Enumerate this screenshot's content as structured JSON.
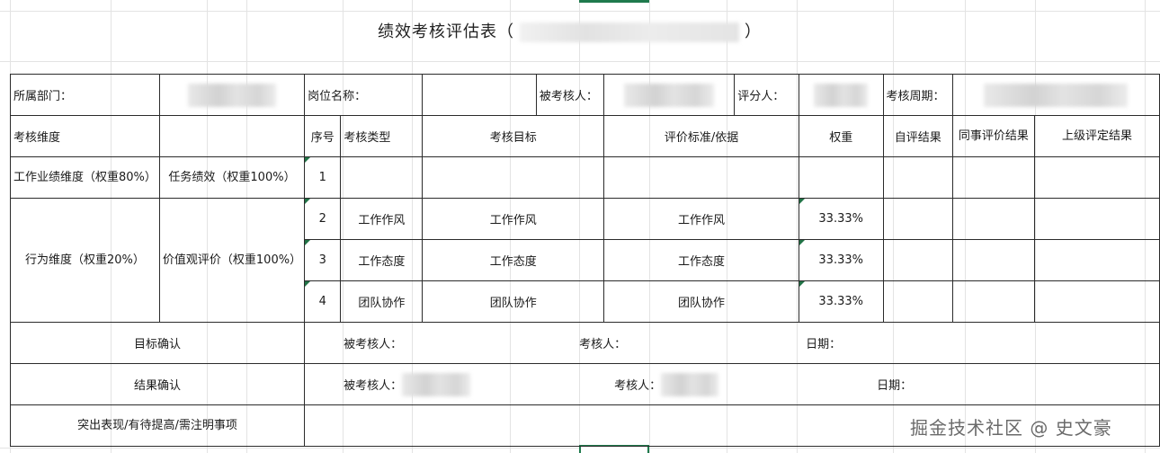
{
  "title": {
    "left": "绩效考核评估表（",
    "right": "）"
  },
  "header": {
    "dept_label": "所属部门：",
    "position_label": "岗位名称：",
    "assessee_label": "被考核人：",
    "rater_label": "评分人：",
    "period_label": "考核周期："
  },
  "columns": {
    "dimension": "考核维度",
    "seq": "序号",
    "type": "考核类型",
    "goal": "考核目标",
    "criteria": "评价标准/依据",
    "weight": "权重",
    "self_eval": "自评结果",
    "peer_eval": "同事评价结果",
    "superior_eval": "上级评定结果"
  },
  "sections": {
    "performance_dim": "工作业绩维度（权重80%）",
    "task_perf": "任务绩效（权重100%）",
    "behavior_dim": "行为维度（权重20%）",
    "value_eval": "价值观评价（权重100%）"
  },
  "rows": [
    {
      "seq": "1",
      "type": "",
      "goal": "",
      "criteria": "",
      "weight": ""
    },
    {
      "seq": "2",
      "type": "工作作风",
      "goal": "工作作风",
      "criteria": "工作作风",
      "weight": "33.33%"
    },
    {
      "seq": "3",
      "type": "工作态度",
      "goal": "工作态度",
      "criteria": "工作态度",
      "weight": "33.33%"
    },
    {
      "seq": "4",
      "type": "团队协作",
      "goal": "团队协作",
      "criteria": "团队协作",
      "weight": "33.33%"
    }
  ],
  "footer": {
    "goal_confirm": "目标确认",
    "result_confirm": "结果确认",
    "assessee": "被考核人：",
    "assessor": "考核人：",
    "date": "日期：",
    "remarks": "突出表现/有待提高/需注明事项"
  },
  "watermark": "掘金技术社区 @ 史文豪"
}
